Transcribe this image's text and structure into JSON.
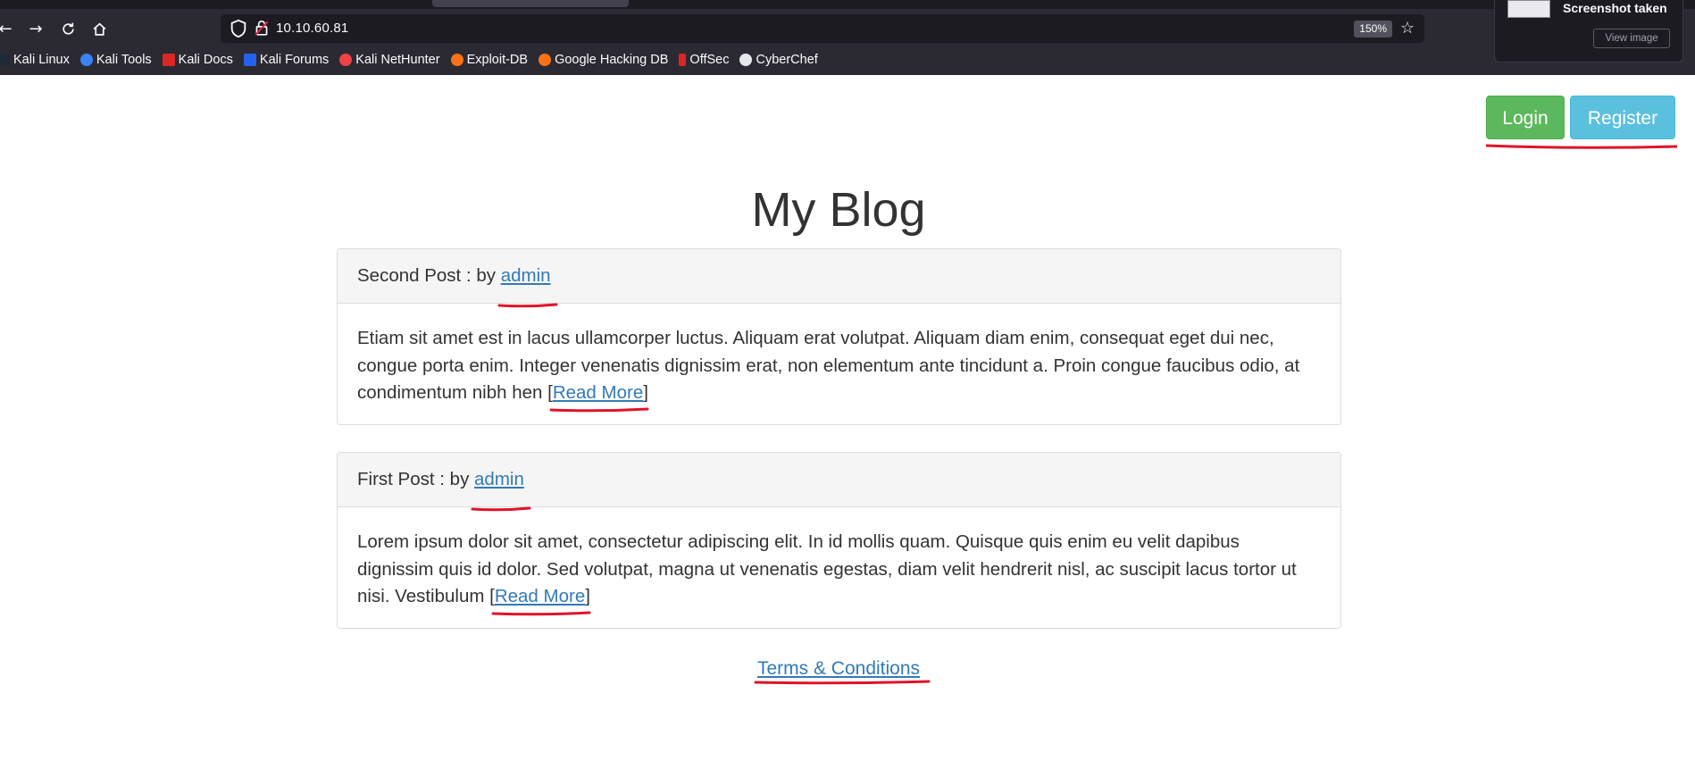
{
  "browser": {
    "url": "10.10.60.81",
    "zoom": "150%",
    "bookmarks": [
      "Kali Linux",
      "Kali Tools",
      "Kali Docs",
      "Kali Forums",
      "Kali NetHunter",
      "Exploit-DB",
      "Google Hacking DB",
      "OffSec",
      "CyberChef"
    ],
    "notification": {
      "title": "Screenshot taken",
      "button": "View image"
    }
  },
  "header": {
    "login_label": "Login",
    "register_label": "Register"
  },
  "page": {
    "title": "My Blog",
    "posts": [
      {
        "title": "Second Post",
        "by_prefix": " : by ",
        "author": "admin",
        "excerpt": "Etiam sit amet est in lacus ullamcorper luctus. Aliquam erat volutpat. Aliquam diam enim, consequat eget dui nec, congue porta enim. Integer venenatis dignissim erat, non elementum ante tincidunt a. Proin congue faucibus odio, at condimentum nibh hen ",
        "read_more": "Read More"
      },
      {
        "title": "First Post",
        "by_prefix": " : by ",
        "author": "admin",
        "excerpt": "Lorem ipsum dolor sit amet, consectetur adipiscing elit. In id mollis quam. Quisque quis enim eu velit dapibus dignissim quis id dolor. Sed volutpat, magna ut venenatis egestas, diam velit hendrerit nisl, ac suscipit lacus tortor ut nisi. Vestibulum ",
        "read_more": "Read More"
      }
    ],
    "terms_link": "Terms & Conditions"
  },
  "colors": {
    "link": "#337ab7",
    "login_green": "#5cb85c",
    "register_blue": "#5bc0de",
    "annotation_red": "#e0132a"
  }
}
